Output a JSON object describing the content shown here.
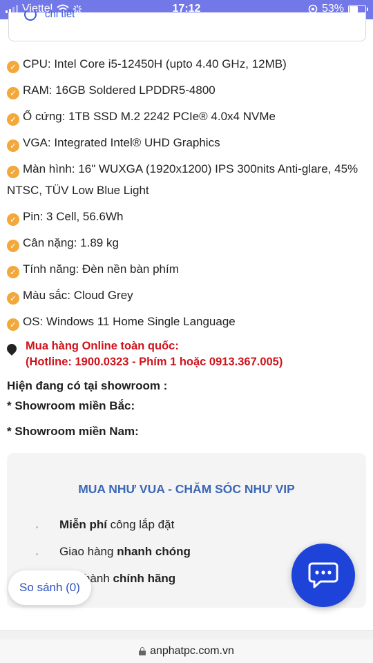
{
  "status_bar": {
    "carrier": "Viettel",
    "time": "17:12",
    "battery": "53%",
    "battery_level": 0.53
  },
  "top_card": {
    "link_text": "chi tiết"
  },
  "specs": [
    {
      "text": "CPU: Intel Core i5-12450H (upto 4.40 GHz, 12MB)"
    },
    {
      "text": "RAM: 16GB Soldered LPDDR5-4800"
    },
    {
      "text": "Ổ cứng: 1TB SSD M.2 2242 PCIe® 4.0x4 NVMe"
    },
    {
      "text": "VGA: Integrated Intel® UHD Graphics"
    },
    {
      "text": "Màn hình: 16\" WUXGA (1920x1200) IPS 300nits Anti-glare, 45% NTSC, TÜV Low Blue Light"
    },
    {
      "text": "Pin: 3 Cell, 56.6Wh"
    },
    {
      "text": "Cân nặng: 1.89 kg"
    },
    {
      "text": "Tính năng: Đèn nền bàn phím"
    },
    {
      "text": "Màu sắc: Cloud Grey"
    },
    {
      "text": "OS: Windows 11 Home Single Language"
    }
  ],
  "online": {
    "line1": "Mua hàng Online toàn quốc:",
    "line2": "(Hotline: 1900.0323 - Phím 1 hoặc 0913.367.005)"
  },
  "showroom": {
    "heading": "Hiện đang có tại showroom :",
    "north": "* Showroom miền Bắc:",
    "south": "* Showroom miền Nam:"
  },
  "promo": {
    "title": "MUA NHƯ VUA - CHĂM SÓC NHƯ VIP",
    "line1_bold": "Miễn phí",
    "line1_rest": " công lắp đặt",
    "line2_rest": "Giao hàng ",
    "line2_bold": "nhanh chóng",
    "line3_rest": "Bảo hành ",
    "line3_bold": "chính hãng"
  },
  "compare_label": "So sánh (0)",
  "url": "anphatpc.com.vn",
  "colors": {
    "status_bar": "#7378e8",
    "check": "#f2a83b",
    "hotline": "#d0121b",
    "promo_title": "#3b67b7",
    "chat": "#1e43d8"
  }
}
